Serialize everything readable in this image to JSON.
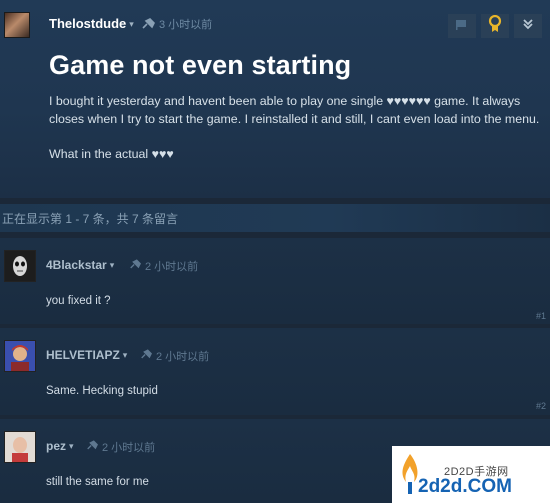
{
  "op": {
    "author": "Thelostdude",
    "caret": "▾",
    "time": "3 小时以前",
    "title": "Game not even starting",
    "body": [
      "I bought it yesterday and havent been able to play one single ♥♥♥♥♥♥ game. It always closes when I try to start the game. I reinstalled it and still, I cant even load into the menu.",
      "What in the actual ♥♥♥"
    ],
    "actions": [
      "flag-icon",
      "award-icon",
      "expand-icon"
    ]
  },
  "count_text": "正在显示第 1 - 7 条，共 7 条留言",
  "replies": [
    {
      "author": "4Blackstar",
      "time": "2 小时以前",
      "text": "you fixed it ?",
      "number": "#1"
    },
    {
      "author": "HELVETIAPZ",
      "time": "2 小时以前",
      "text": "Same. Hecking stupid",
      "number": "#2"
    },
    {
      "author": "pez",
      "time": "2 小时以前",
      "text": "still the same for me",
      "number": ""
    }
  ],
  "watermark": {
    "sub": "2D2D手游网",
    "main": "2d2d.COM"
  },
  "colors": {
    "background": "#1b2838",
    "award": "#e8b52a",
    "watermark_blue": "#1563b3"
  }
}
